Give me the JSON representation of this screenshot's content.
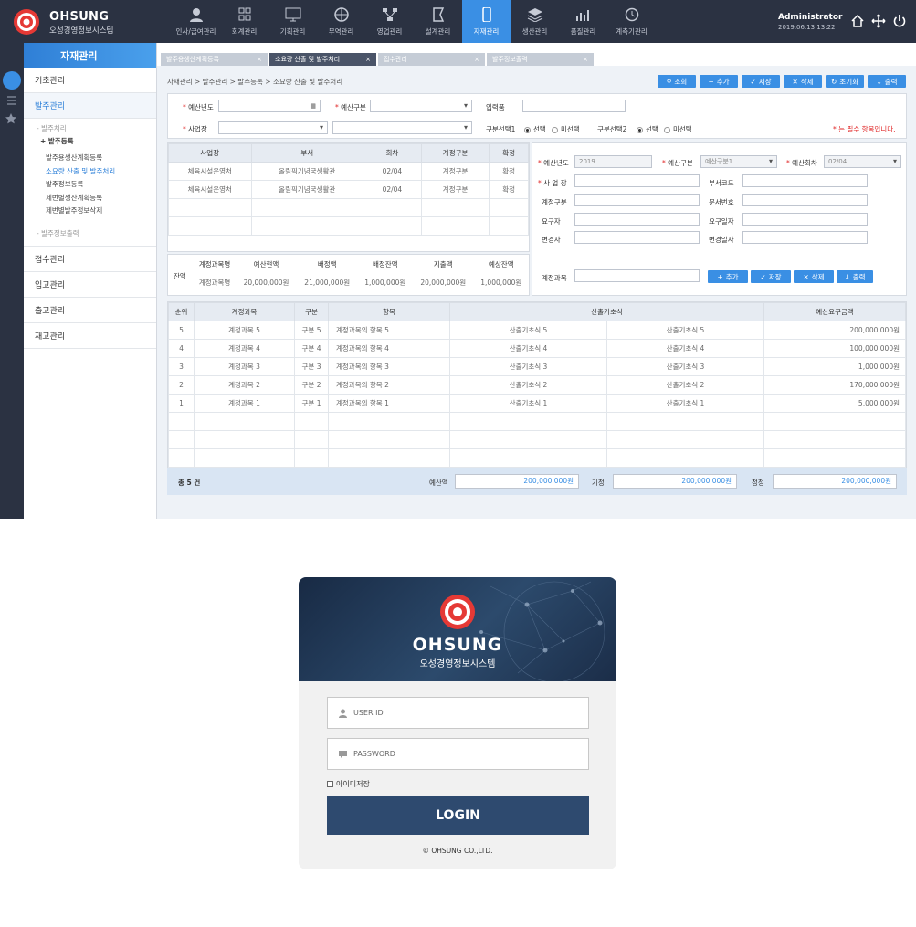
{
  "app": {
    "brand": "OHSUNG",
    "brand_sub": "오성경영정보시스템",
    "user": "Administrator",
    "datetime": "2019.06.13 13:22"
  },
  "nav": [
    {
      "label": "인사/급여관리",
      "icon": "person-icon"
    },
    {
      "label": "회계관리",
      "icon": "grid-icon"
    },
    {
      "label": "기획관리",
      "icon": "monitor-icon"
    },
    {
      "label": "무역관리",
      "icon": "globe-icon"
    },
    {
      "label": "영업관리",
      "icon": "network-icon"
    },
    {
      "label": "설계관리",
      "icon": "flag-icon"
    },
    {
      "label": "자재관리",
      "icon": "device-icon"
    },
    {
      "label": "생산관리",
      "icon": "layers-icon"
    },
    {
      "label": "품질관리",
      "icon": "chart-icon"
    },
    {
      "label": "계측기관리",
      "icon": "history-icon"
    }
  ],
  "sidebar": {
    "title": "자재관리",
    "menu": [
      "기초관리",
      "발주관리",
      "접수관리",
      "입고관리",
      "출고관리",
      "재고관리"
    ],
    "sub_header": "- 발주처리",
    "sub_group": "+ 발주등록",
    "sub_items": [
      "발주용생산계획등록",
      "소요량 산출 및 발주처리",
      "발주정보등록",
      "제번별생산계획등록",
      "제번별발주정보삭제"
    ],
    "sub_footer": "- 발주정보출력"
  },
  "tabs": [
    "발주용생산계획등록",
    "소요량 산출 및 발주처리",
    "접수관리",
    "발주정보출력"
  ],
  "breadcrumb": "자재관리 > 발주관리 > 발주등록 > 소요량 산출 및 발주처리",
  "toolbar": [
    "조회",
    "추가",
    "저장",
    "삭제",
    "초기화",
    "출력"
  ],
  "search": {
    "year_label": "예산년도",
    "type_label": "예산구분",
    "input_label": "입력품",
    "site_label": "사업장",
    "sel1_label": "구분선택1",
    "sel2_label": "구분선택2",
    "opt_select": "선택",
    "opt_unselect": "미선택",
    "required_note": "* 는 필수 항목입니다."
  },
  "top_table": {
    "headers": [
      "사업장",
      "부서",
      "회차",
      "계정구분",
      "확정"
    ],
    "rows": [
      [
        "체육시설운영처",
        "올림픽기념국생활관",
        "02/04",
        "계정구분",
        "확정"
      ],
      [
        "체육시설운영처",
        "올림픽기념국생활관",
        "02/04",
        "계정구분",
        "확정"
      ]
    ]
  },
  "balance": {
    "label": "잔액",
    "headers": [
      "계정과목명",
      "예산현액",
      "배정액",
      "배정잔액",
      "지출액",
      "예상잔액"
    ],
    "row": [
      "계정과목명",
      "20,000,000원",
      "21,000,000원",
      "1,000,000원",
      "20,000,000원",
      "1,000,000원"
    ]
  },
  "detail": {
    "year_label": "예산년도",
    "year_value": "2019",
    "type_label": "예산구분",
    "type_value": "예산구분1",
    "round_label": "예산회차",
    "round_value": "02/04",
    "site_label": "사 업 장",
    "deptcode_label": "부서코드",
    "acct_label": "계정구분",
    "docno_label": "문서번호",
    "req_label": "요구자",
    "reqdate_label": "요구일자",
    "chg_label": "변경자",
    "chgdate_label": "변경일자",
    "subject_label": "계정과목"
  },
  "detail_buttons": [
    "추가",
    "저장",
    "삭제",
    "출력"
  ],
  "main_table": {
    "headers": [
      "순위",
      "계정과목",
      "구분",
      "항목",
      "산출기초식",
      "예산요구금액"
    ],
    "rows": [
      [
        "5",
        "계정과목 5",
        "구분 5",
        "계정과목의 항목 5",
        "산출기초식 5",
        "산출기초식 5",
        "200,000,000원"
      ],
      [
        "4",
        "계정과목 4",
        "구분 4",
        "계정과목의 항목 4",
        "산출기초식 4",
        "산출기초식 4",
        "100,000,000원"
      ],
      [
        "3",
        "계정과목 3",
        "구분 3",
        "계정과목의 항목 3",
        "산출기초식 3",
        "산출기초식 3",
        "1,000,000원"
      ],
      [
        "2",
        "계정과목 2",
        "구분 2",
        "계정과목의 항목 2",
        "산출기초식 2",
        "산출기초식 2",
        "170,000,000원"
      ],
      [
        "1",
        "계정과목 1",
        "구분 1",
        "계정과목의 항목 1",
        "산출기초식 1",
        "산출기초식 1",
        "5,000,000원"
      ]
    ]
  },
  "summary": {
    "total": "총 5 건",
    "budget_label": "예산액",
    "budget": "200,000,000원",
    "prev_label": "기정",
    "prev": "200,000,000원",
    "adj_label": "정정",
    "adj": "200,000,000원"
  },
  "login": {
    "brand": "OHSUNG",
    "brand_sub": "오성경영정보시스템",
    "user_placeholder": "USER ID",
    "pw_placeholder": "PASSWORD",
    "remember": "아이디저장",
    "button": "LOGIN",
    "copyright": "© OHSUNG CO.,LTD."
  },
  "colors": {
    "accent": "#3a8fe4",
    "topbar": "#2b3242",
    "required": "#e02525",
    "login_button": "#2e4a6f"
  }
}
